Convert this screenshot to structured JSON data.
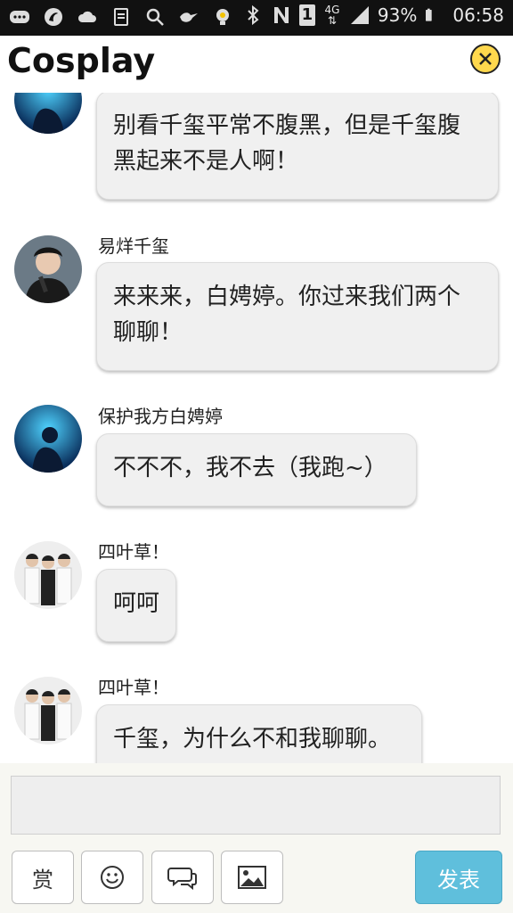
{
  "status_bar": {
    "icons_left": [
      "chat-bubble-icon",
      "browser-icon",
      "cloud-icon",
      "notes-icon",
      "search-icon",
      "bird-icon",
      "bulb-icon"
    ],
    "icons_right": [
      "bluetooth-icon",
      "nfc-icon",
      "sim-icon",
      "network-icon",
      "signal-icon",
      "battery-icon"
    ],
    "sim_number": "1",
    "network_label": "4G",
    "battery": "93%",
    "time": "06:58"
  },
  "header": {
    "title": "Cosplay"
  },
  "messages": [
    {
      "name": "",
      "text_line1": "别看千玺平常不腹黑，但是千玺腹",
      "text_line2": "黑起来不是人啊！",
      "avatar": "avatar-dark-blue"
    },
    {
      "name": "易烊千玺",
      "text_line1": "来来来，白娉婷。你过来我们两个",
      "text_line2": "聊聊！",
      "avatar": "avatar-boy-mic"
    },
    {
      "name": "保护我方白娉婷",
      "text_line1": "不不不，我不去（我跑~）",
      "text_line2": "",
      "avatar": "avatar-dark-blue"
    },
    {
      "name": "四叶草！",
      "text_line1": "呵呵",
      "text_line2": "",
      "avatar": "avatar-group"
    },
    {
      "name": "四叶草！",
      "text_line1": "千玺，为什么不和我聊聊。",
      "text_line2": "",
      "avatar": "avatar-group"
    }
  ],
  "input_bar": {
    "placeholder": "",
    "reward_label": "赏",
    "send_label": "发表"
  },
  "colors": {
    "status_bar": "#111111",
    "accent_send": "#5fbfdc",
    "close_button": "#ffd84d",
    "bubble_bg": "#f0f0f0"
  }
}
